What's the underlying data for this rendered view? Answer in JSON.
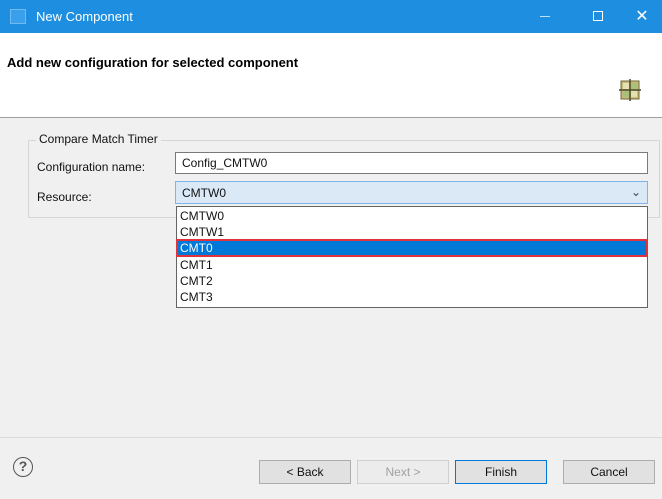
{
  "window": {
    "title": "New Component"
  },
  "header": {
    "title": "Add new configuration for selected component"
  },
  "group": {
    "legend": "Compare Match Timer",
    "config_name_label": "Configuration name:",
    "config_name_value": "Config_CMTW0",
    "resource_label": "Resource:",
    "resource_value": "CMTW0",
    "options": [
      "CMTW0",
      "CMTW1",
      "CMT0",
      "CMT1",
      "CMT2",
      "CMT3"
    ],
    "highlighted_option": "CMT0"
  },
  "footer": {
    "help": "?",
    "back": "< Back",
    "next": "Next >",
    "finish": "Finish",
    "cancel": "Cancel"
  },
  "colors": {
    "titlebar": "#1e8fe0",
    "selection": "#0078d7",
    "highlight_outline": "#e0333c"
  }
}
